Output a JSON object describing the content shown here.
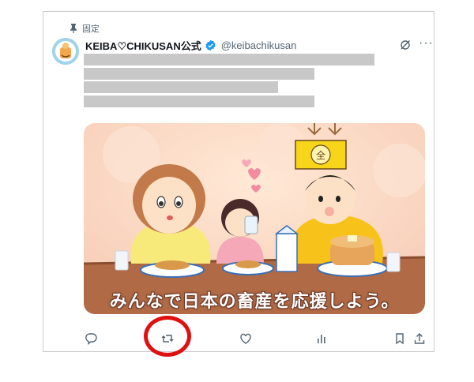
{
  "post": {
    "pinned_label": "固定",
    "display_name": "KEIBA♡CHIKUSAN公式",
    "handle": "@keibachikusan",
    "image_caption": "みんなで日本の畜産を応援しよう。",
    "image_sign_symbol": "全"
  },
  "icons": {
    "pin": "pin-icon",
    "verified": "verified-badge-icon",
    "grok": "grok-icon",
    "more": "more-icon",
    "reply": "reply-icon",
    "repost": "repost-icon",
    "like": "heart-icon",
    "views": "views-icon",
    "bookmark": "bookmark-icon",
    "share": "share-icon"
  },
  "colors": {
    "verified": "#1d9bf0",
    "highlight": "#e01010",
    "icon": "#536471"
  }
}
